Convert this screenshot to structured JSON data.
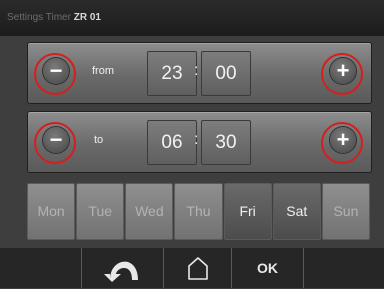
{
  "breadcrumb": {
    "items": [
      "Settings",
      "Timer"
    ],
    "current": "ZR 01"
  },
  "timer": {
    "from_label": "from",
    "from_hours": "23",
    "from_minutes": "00",
    "to_label": "to",
    "to_hours": "06",
    "to_minutes": "30",
    "separator": ":",
    "decrease_symbol": "−",
    "increase_symbol": "+"
  },
  "days": [
    {
      "label": "Mon",
      "active": false
    },
    {
      "label": "Tue",
      "active": false
    },
    {
      "label": "Wed",
      "active": false
    },
    {
      "label": "Thu",
      "active": false
    },
    {
      "label": "Fri",
      "active": true
    },
    {
      "label": "Sat",
      "active": true
    },
    {
      "label": "Sun",
      "active": false
    }
  ],
  "nav": {
    "back_icon": "back-arrow-icon",
    "home_icon": "home-icon",
    "ok_label": "OK"
  },
  "colors": {
    "highlight_ring": "#d51f1f"
  }
}
